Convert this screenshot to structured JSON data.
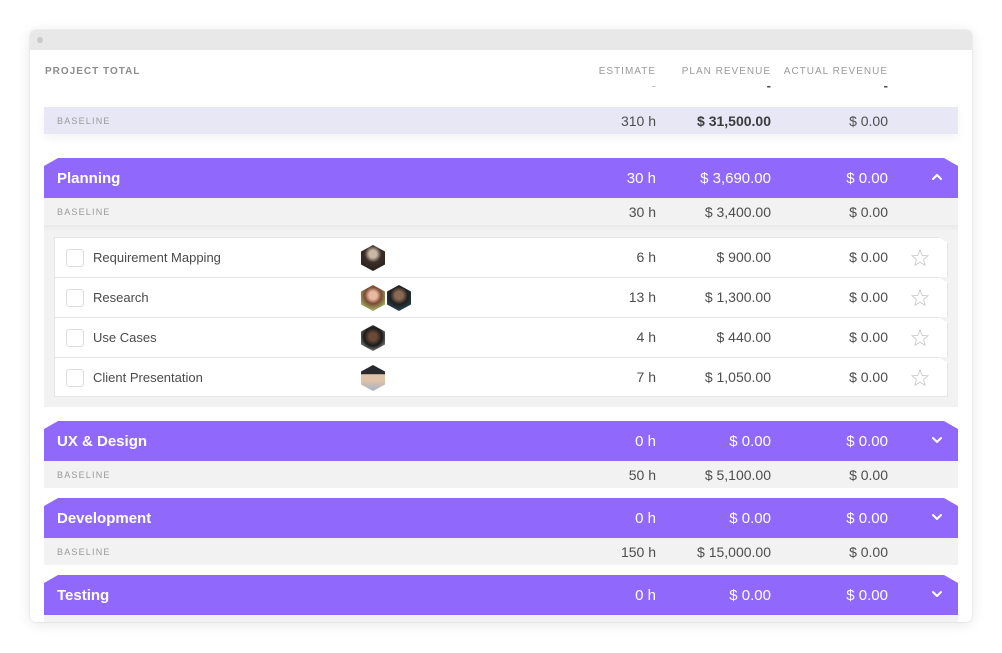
{
  "window": {
    "title_dots": 1
  },
  "project_total": {
    "title": "PROJECT TOTAL",
    "columns": {
      "estimate": {
        "label": "ESTIMATE",
        "value": "-"
      },
      "plan_revenue": {
        "label": "PLAN REVENUE",
        "value": "-"
      },
      "actual_revenue": {
        "label": "ACTUAL REVENUE",
        "value": "-"
      }
    },
    "baseline": {
      "label": "BASELINE",
      "estimate": "310 h",
      "plan_revenue": "$ 31,500.00",
      "actual_revenue": "$ 0.00"
    }
  },
  "colors": {
    "phase_header": "#9069fc",
    "total_baseline_bg": "#e8e7f6",
    "phase_baseline_bg": "#f2f2f2"
  },
  "phases": [
    {
      "name": "Planning",
      "estimate": "30 h",
      "plan_revenue": "$ 3,690.00",
      "actual_revenue": "$ 0.00",
      "expanded": true,
      "chevron": "chevron-up-icon",
      "baseline": {
        "label": "BASELINE",
        "estimate": "30 h",
        "plan_revenue": "$ 3,400.00",
        "actual_revenue": "$ 0.00"
      },
      "tasks": [
        {
          "name": "Requirement Mapping",
          "estimate": "6 h",
          "plan_revenue": "$ 900.00",
          "actual_revenue": "$ 0.00",
          "assignees": [
            "avatar-1"
          ],
          "starred": false
        },
        {
          "name": "Research",
          "estimate": "13 h",
          "plan_revenue": "$ 1,300.00",
          "actual_revenue": "$ 0.00",
          "assignees": [
            "avatar-2",
            "avatar-3"
          ],
          "starred": false
        },
        {
          "name": "Use Cases",
          "estimate": "4 h",
          "plan_revenue": "$ 440.00",
          "actual_revenue": "$ 0.00",
          "assignees": [
            "avatar-4"
          ],
          "starred": false
        },
        {
          "name": "Client Presentation",
          "estimate": "7 h",
          "plan_revenue": "$ 1,050.00",
          "actual_revenue": "$ 0.00",
          "assignees": [
            "avatar-5"
          ],
          "starred": false
        }
      ]
    },
    {
      "name": "UX & Design",
      "estimate": "0 h",
      "plan_revenue": "$ 0.00",
      "actual_revenue": "$ 0.00",
      "expanded": false,
      "chevron": "chevron-down-icon",
      "baseline": {
        "label": "BASELINE",
        "estimate": "50 h",
        "plan_revenue": "$ 5,100.00",
        "actual_revenue": "$ 0.00"
      }
    },
    {
      "name": "Development",
      "estimate": "0 h",
      "plan_revenue": "$ 0.00",
      "actual_revenue": "$ 0.00",
      "expanded": false,
      "chevron": "chevron-down-icon",
      "baseline": {
        "label": "BASELINE",
        "estimate": "150 h",
        "plan_revenue": "$ 15,000.00",
        "actual_revenue": "$ 0.00"
      }
    },
    {
      "name": "Testing",
      "estimate": "0 h",
      "plan_revenue": "$ 0.00",
      "actual_revenue": "$ 0.00",
      "expanded": false,
      "chevron": "chevron-down-icon"
    }
  ]
}
